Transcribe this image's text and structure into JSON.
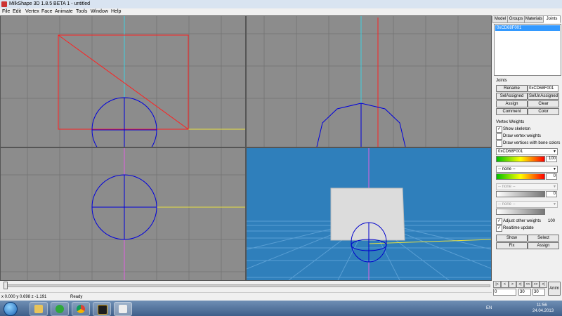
{
  "window": {
    "title": "MilkShape 3D 1.8.5 BETA 1 - untitled"
  },
  "menu": [
    "File",
    "Edit",
    "Vertex",
    "Face",
    "Animate",
    "Tools",
    "Window",
    "Help"
  ],
  "tabs": [
    {
      "label": "Model",
      "active": false
    },
    {
      "label": "Groups",
      "active": false
    },
    {
      "label": "Materials",
      "active": false
    },
    {
      "label": "Joints",
      "active": true
    }
  ],
  "joints_list": {
    "selected": "0xCD68F001"
  },
  "joints": {
    "section_label": "Joints",
    "rename_button": "Rename",
    "name_value": "0xCD68F001",
    "set_assigned_button": "SelAssigned",
    "set_unassigned_button": "SelUnAssigned",
    "assign_button": "Assign",
    "clear_button": "Clear",
    "comment_button": "Comment",
    "color_button": "Color"
  },
  "vertex_weights": {
    "section_label": "Vertex Weights",
    "show_skeleton": {
      "label": "Show skeleton",
      "checked": true
    },
    "draw_vertex_weights": {
      "label": "Draw vertex weights",
      "checked": false
    },
    "draw_vertices_bone_colors": {
      "label": "Draw vertices with bone colors",
      "checked": false
    },
    "combo1": "0xCD68F001",
    "weight1": "100",
    "combo2": "-- none --",
    "weight2": "0",
    "combo3": "-- none --",
    "weight3": "0",
    "combo4": "-- none --",
    "adjust_other_weights": {
      "label": "Adjust other weights",
      "checked": true,
      "value": "100"
    },
    "realtime_update": {
      "label": "Realtime update",
      "checked": true
    },
    "show_button": "Show",
    "select_button": "Select",
    "fix_button": "Fix",
    "assign_button": "Assign"
  },
  "transport": {
    "buttons": [
      "|<",
      "<",
      ">",
      ">|",
      "<<",
      ">>",
      ">|"
    ],
    "frame_start": "0",
    "frame_current": "30",
    "frame_end": "30",
    "anim_button": "Anim"
  },
  "status": {
    "coordinates": "x 0.000 y 0.698 z -1.191",
    "message": "Ready"
  },
  "taskbar": {
    "lang": "EN",
    "time": "11:56",
    "date": "24.04.2013",
    "items": [
      "explorer",
      "icq",
      "chrome",
      "winamp",
      "milkshape"
    ]
  },
  "colors": {
    "viewport_grey": "#8c8c8c",
    "viewport_blue": "#2f7fbb",
    "selection": "#3399ff",
    "box_red": "#ff2020",
    "joint_blue": "#0000dd"
  }
}
